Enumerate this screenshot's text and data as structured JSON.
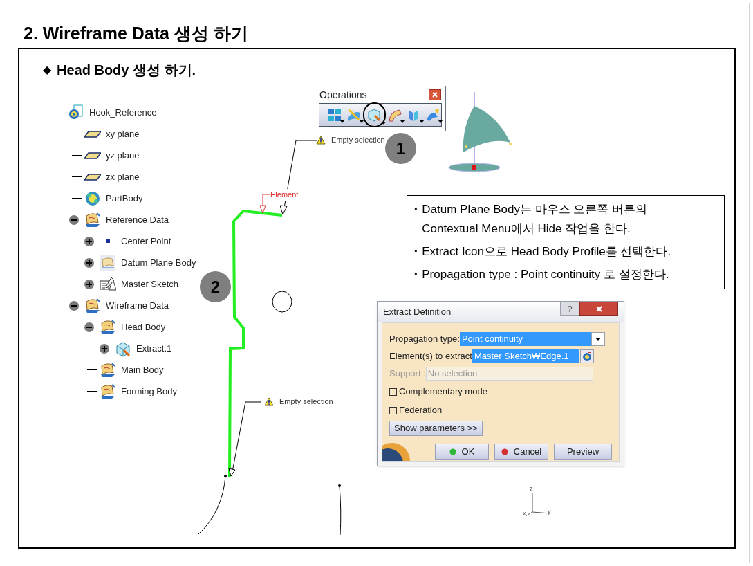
{
  "title": "2. Wireframe Data 생성 하기",
  "section": {
    "bullet": "◆",
    "title": "Head Body 생성 하기."
  },
  "tree": {
    "label": "Hook_Reference",
    "kind": "document",
    "selected": false,
    "children": [
      {
        "label": "xy plane",
        "kind": "plane",
        "selected": false
      },
      {
        "label": "yz plane",
        "kind": "plane",
        "selected": false
      },
      {
        "label": "zx plane",
        "kind": "plane",
        "selected": false
      },
      {
        "label": "PartBody",
        "kind": "body",
        "selected": false
      },
      {
        "label": "Reference Data",
        "kind": "set",
        "selected": false,
        "expanded": true,
        "children": [
          {
            "label": "Center Point",
            "kind": "point",
            "selected": false,
            "expanded": false
          },
          {
            "label": "Datum Plane Body",
            "kind": "datum",
            "selected": false,
            "expanded": false
          },
          {
            "label": "Master Sketch",
            "kind": "sketch",
            "selected": false,
            "expanded": false
          }
        ]
      },
      {
        "label": "Wireframe Data",
        "kind": "set",
        "selected": false,
        "expanded": true,
        "children": [
          {
            "label": "Head Body",
            "kind": "set",
            "selected": true,
            "expanded": true,
            "children": [
              {
                "label": "Extract.1",
                "kind": "extract",
                "selected": false,
                "expanded": false
              }
            ]
          },
          {
            "label": "Main Body",
            "kind": "set",
            "selected": false
          },
          {
            "label": "Forming Body",
            "kind": "set",
            "selected": false
          }
        ]
      }
    ]
  },
  "toolbar": {
    "title": "Operations",
    "buttons": [
      {
        "kind": "join",
        "circled": false
      },
      {
        "kind": "healing",
        "circled": false
      },
      {
        "kind": "extract",
        "circled": true
      },
      {
        "kind": "fillet",
        "circled": false
      },
      {
        "kind": "transform",
        "circled": false
      },
      {
        "kind": "extrapolate",
        "circled": false
      }
    ]
  },
  "callouts": [
    "1",
    "2"
  ],
  "viewport": {
    "element_label": "Element",
    "warnings": [
      "Empty selection",
      "Empty selection"
    ],
    "axis": [
      "z",
      "x",
      "y"
    ]
  },
  "note": {
    "bullet": "▪",
    "items": [
      "Datum Plane Body는 마우스 오른쪽 버튼의 Contextual Menu에서 Hide 작업을 한다.",
      "Extract Icon으로 Head Body Profile를 선택한다.",
      "Propagation type : Point continuity 로 설정한다."
    ]
  },
  "dialog": {
    "title": "Extract Definition",
    "help": "?",
    "fields": [
      {
        "kind": "combo",
        "label": "Propagation type:",
        "value": "Point continuity",
        "selected": true,
        "disabled": false
      },
      {
        "kind": "picker",
        "label": "Element(s) to extract",
        "value": "Master Sketch₩Edge.1",
        "selected": true,
        "disabled": false
      },
      {
        "kind": "text",
        "label": "Support :",
        "value": "No selection",
        "selected": false,
        "disabled": true
      }
    ],
    "checkboxes": [
      {
        "label": "Complementary mode",
        "checked": false
      },
      {
        "label": "Federation",
        "checked": false
      }
    ],
    "more_button": "Show parameters >>",
    "buttons": [
      {
        "kind": "ok",
        "label": "OK"
      },
      {
        "kind": "cancel",
        "label": "Cancel"
      },
      {
        "kind": "plain",
        "label": "Preview"
      }
    ]
  }
}
